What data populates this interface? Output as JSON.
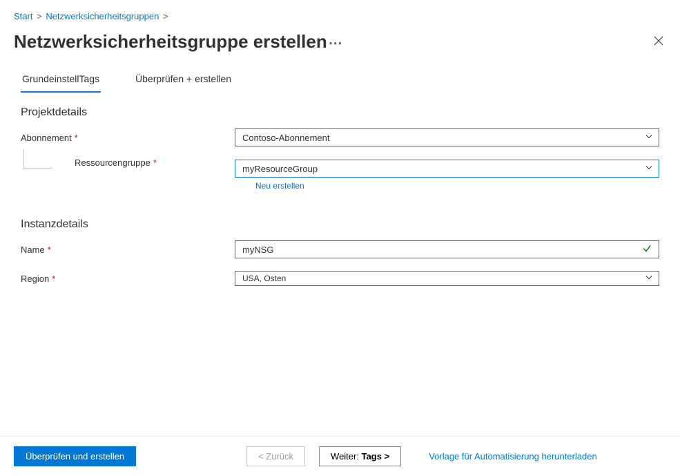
{
  "breadcrumb": {
    "start": "Start",
    "nsg": "Netzwerksicherheitsgruppen"
  },
  "header": {
    "title": "Netzwerksicherheitsgruppe erstellen"
  },
  "tabs": {
    "basics_first": "Grundeinstell",
    "tags": "Tags",
    "review": "Überprüfen + erstellen"
  },
  "sections": {
    "projectDetails": "Projektdetails",
    "instanceDetails": "Instanzdetails"
  },
  "fields": {
    "subscription": {
      "label": "Abonnement",
      "value": "Contoso-Abonnement"
    },
    "resourceGroup": {
      "label": "Ressourcengruppe",
      "value": "myResourceGroup",
      "newLink": "Neu erstellen"
    },
    "name": {
      "label": "Name",
      "value": "myNSG"
    },
    "region": {
      "label": "Region",
      "value": "USA, Osten"
    }
  },
  "footer": {
    "review": "Überprüfen und erstellen",
    "back": "< Zurück",
    "nextPrefix": "Weiter:",
    "nextSuffix": "Tags >",
    "download": "Vorlage für Automatisierung herunterladen"
  }
}
